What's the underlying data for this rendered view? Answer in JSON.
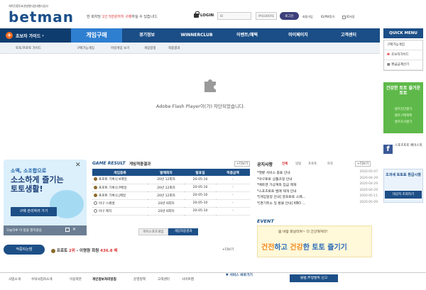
{
  "header": {
    "logo_sub": "체육진흥투표권발행사업대행사업자",
    "logo": "betman",
    "greet_pre": "한 회차당 ",
    "greet_red": "1인 5만원까지 구매",
    "greet_post": "하실 수 있습니다.",
    "login_label": "LOGIN",
    "id_placeholder": "ID",
    "password_placeholder": "PASSWORD",
    "login_button": "로그인",
    "join": "회원가입",
    "find": "ID/PW찾기",
    "save_id": "ID저장"
  },
  "nav": {
    "beginner": "초보자 가이드",
    "items": [
      "게임구매",
      "경기정보",
      "WINNERCLUB",
      "이벤트/혜택",
      "마이페이지",
      "고객센터"
    ]
  },
  "subnav": {
    "left": "토토/프로토 가이드",
    "items": [
      "구매가능게임",
      "마감게임 보기",
      "게임일정",
      "적중결과"
    ]
  },
  "flash": {
    "message": "Adobe Flash Player이(가) 차단되었습니다."
  },
  "quick_menu": {
    "title": "QUICK MENU",
    "items": [
      "구매가능게임",
      "초보자가이드",
      "환급금계산기"
    ],
    "green_title": "건강한 토토 즐거운 토토",
    "green_links": [
      "셀프진단평가",
      "셀프구매계획",
      "셀프조사평가"
    ],
    "facebook": "f",
    "facebook_text": "스포츠토토 페이스북",
    "refund_title": "조과세 토토표 환급시행",
    "refund_button": "대상자 조회하기"
  },
  "promo": {
    "line1": "소액, 소조합으로",
    "line2": "소소하게 즐기는 토토생활!",
    "button": "구매 관리하러 가기",
    "foot": "오늘하루 이 창을 열지않음",
    "close": "✕"
  },
  "game_result": {
    "title": "GAME RESULT",
    "subtitle": "게임적중결과",
    "more": "+더보기",
    "headers": [
      "게임종류",
      "발매회차",
      "발표일",
      "적중금액"
    ],
    "rows": [
      {
        "name": "프로토 기록식 K메일",
        "round": "20년 12회차",
        "date": "20-05-10",
        "amount": "-"
      },
      {
        "name": "프로토 기록식 P메일",
        "round": "20년 12회차",
        "date": "20-05-10",
        "amount": "-"
      },
      {
        "name": "프로토 기록식 J메일",
        "round": "20년 12회차",
        "date": "20-05-10",
        "amount": "-"
      },
      {
        "name": "야구 스페셜",
        "round": "20년 6회차",
        "date": "20-05-10",
        "amount": "-"
      },
      {
        "name": "야구 매치",
        "round": "20년 6회차",
        "date": "20-05-10",
        "amount": "-"
      }
    ],
    "tab_off": "마이스포츠게임",
    "tab_on": "게임적중결과"
  },
  "notice": {
    "title": "공지사항",
    "tabs": [
      "전체",
      "알림",
      "프로토",
      "토토"
    ],
    "more": "+더보기",
    "items": [
      {
        "text": "*햇볕 서비스 종료 안내",
        "date": "2020-05-07"
      },
      {
        "text": "*야구토토 상품규정 안내",
        "date": "2020-04-29"
      },
      {
        "text": "*베트맨 가상계좌 입금 제재",
        "date": "2020-04-29"
      },
      {
        "text": "*스포츠토토 발매 재개 안내",
        "date": "2020-04-29"
      },
      {
        "text": "*[게임일정 안내] 골프토토 스페...",
        "date": "2020-05-11"
      },
      {
        "text": "*[경기취소 및 환불 안내] KBO ...",
        "date": "2020-05-09"
      }
    ]
  },
  "event": {
    "title": "EVENT",
    "line1": "봄 바람 휘날리며~ 더 건강해져라!",
    "line2_a": "건전",
    "line2_b": "하고 ",
    "line2_c": "건강",
    "line2_d": "한 토토 즐기기"
  },
  "result_bar": {
    "label": "적중되는밤",
    "text_pre": "프로토 ",
    "text_red": "2위",
    "text_mid": " - 이명원 회원 ",
    "text_amount": "436.8 배",
    "more": "+더보기"
  },
  "footer": {
    "links": [
      "사업소개",
      "수탁사업자소개",
      "이용약관",
      "개인정보처리방침",
      "운영정책",
      "고객센터",
      "사이트맵"
    ],
    "service": "서비스 바로가기",
    "report": "불법,부정발위 신고"
  }
}
